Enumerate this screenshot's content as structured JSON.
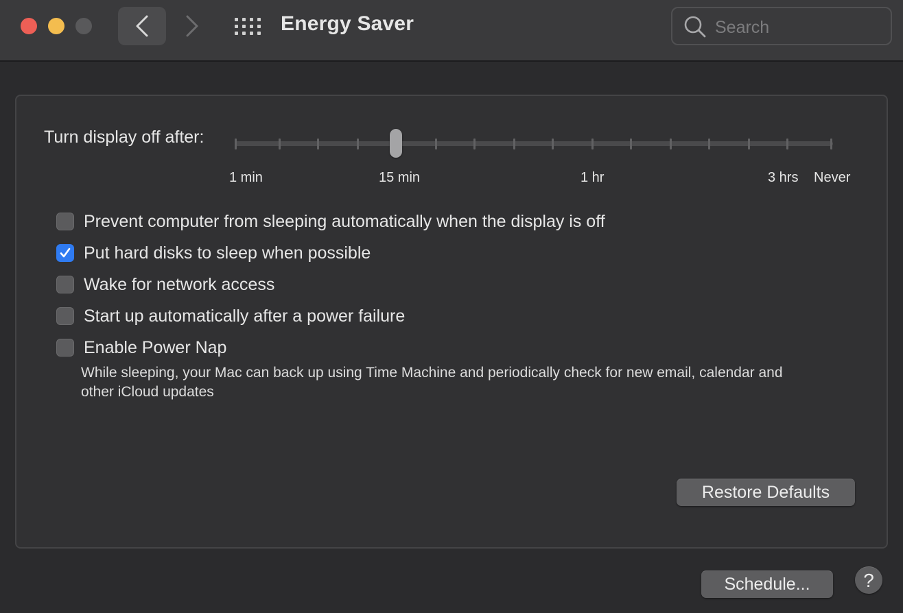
{
  "window": {
    "title": "Energy Saver"
  },
  "toolbar": {
    "search_placeholder": "Search"
  },
  "display_sleep": {
    "label": "Turn display off after:",
    "tick_labels": [
      "1 min",
      "15 min",
      "1 hr",
      "3 hrs",
      "Never"
    ],
    "current_value": "15 min"
  },
  "options": [
    {
      "label": "Prevent computer from sleeping automatically when the display is off",
      "checked": false
    },
    {
      "label": "Put hard disks to sleep when possible",
      "checked": true
    },
    {
      "label": "Wake for network access",
      "checked": false
    },
    {
      "label": "Start up automatically after a power failure",
      "checked": false
    },
    {
      "label": "Enable Power Nap",
      "checked": false
    }
  ],
  "power_nap_description": "While sleeping, your Mac can back up using Time Machine and periodically check for new email, calendar and other iCloud updates",
  "buttons": {
    "restore_defaults": "Restore Defaults",
    "schedule": "Schedule...",
    "help": "?"
  },
  "colors": {
    "close": "#ed5f56",
    "minimize": "#f4bd4f",
    "zoom_disabled": "#59595b",
    "checkbox_checked": "#2f7bf2"
  }
}
